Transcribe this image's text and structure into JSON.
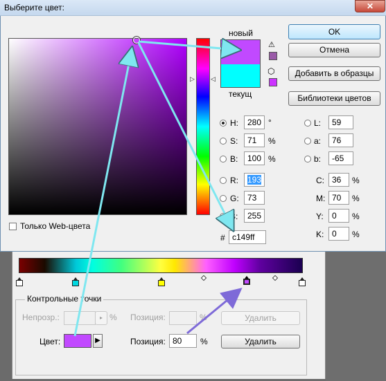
{
  "window": {
    "title": "Выберите цвет:",
    "close_glyph": "✕"
  },
  "color_picker": {
    "new_label": "новый",
    "current_label": "текущ",
    "new_color": "#c149ff",
    "current_color": "#00ffff",
    "hex_prefix": "#",
    "hex_value": "c149ff",
    "web_only_label": "Только Web-цвета",
    "web_only_checked": false
  },
  "buttons": {
    "ok": "OK",
    "cancel": "Отмена",
    "add_to_swatches": "Добавить в образцы",
    "color_libraries": "Библиотеки цветов"
  },
  "hsb": [
    {
      "label": "H:",
      "value": "280",
      "unit": "°",
      "selected": true
    },
    {
      "label": "S:",
      "value": "71",
      "unit": "%",
      "selected": false
    },
    {
      "label": "B:",
      "value": "100",
      "unit": "%",
      "selected": false
    }
  ],
  "rgb": [
    {
      "label": "R:",
      "value": "193",
      "selected": false
    },
    {
      "label": "G:",
      "value": "73",
      "selected": false
    },
    {
      "label": "B:",
      "value": "255",
      "selected": false
    }
  ],
  "lab": [
    {
      "label": "L:",
      "value": "59"
    },
    {
      "label": "a:",
      "value": "76"
    },
    {
      "label": "b:",
      "value": "-65"
    }
  ],
  "cmyk": [
    {
      "label": "C:",
      "value": "36",
      "unit": "%"
    },
    {
      "label": "M:",
      "value": "70",
      "unit": "%"
    },
    {
      "label": "Y:",
      "value": "0",
      "unit": "%"
    },
    {
      "label": "K:",
      "value": "0",
      "unit": "%"
    }
  ],
  "gradient_editor": {
    "group_label": "Контрольные точки",
    "opacity_label": "Непрозр.:",
    "opacity_unit": "%",
    "opacity_position_label": "Позиция:",
    "opacity_position_unit": "%",
    "delete_label": "Удалить",
    "color_label": "Цвет:",
    "color_swatch": "#c149ff",
    "color_position_label": "Позиция:",
    "color_position_value": "80",
    "color_position_unit": "%",
    "color_delete_label": "Удалить",
    "stops": [
      "#ffffff",
      "#00d8e0",
      "#ffff00",
      "#c149ff",
      "#ffffff"
    ]
  },
  "colors": {
    "arrow": "#7fe7f0",
    "arrow_purple": "#7e6ad8"
  }
}
